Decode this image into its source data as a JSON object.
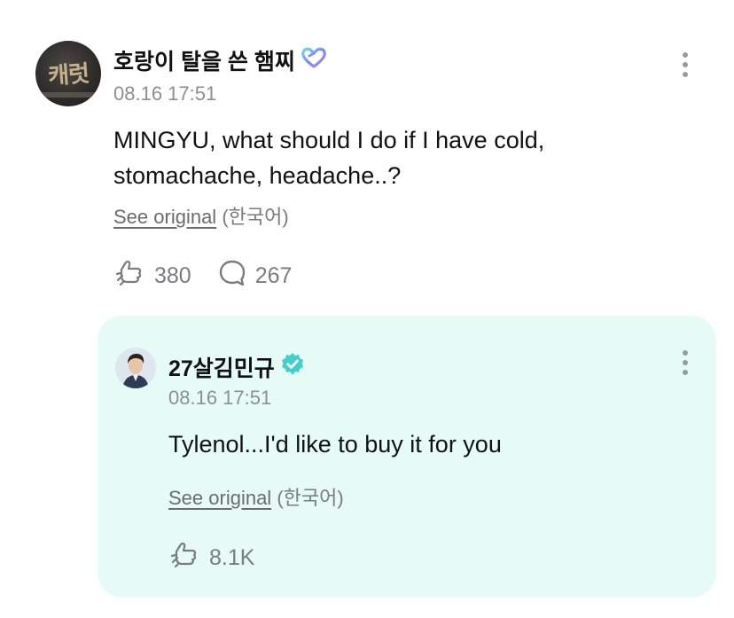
{
  "post": {
    "author_name": "호랑이 탈을 쓴 햄찌",
    "avatar_text": "캐럿",
    "timestamp": "08.16 17:51",
    "body_line1": "MINGYU, what should I do if I have cold,",
    "body_line2": "stomachache, headache..?",
    "see_original": "See original",
    "original_language": "(한국어)",
    "like_count": "380",
    "comment_count": "267",
    "badge_icon": "heart-outline-icon"
  },
  "reply": {
    "author_name": "27살김민규",
    "timestamp": "08.16 17:51",
    "body": "Tylenol...I'd like to buy it for you",
    "see_original": "See original",
    "original_language": "(한국어)",
    "like_count": "8.1K",
    "badge_icon": "verified-check-icon"
  },
  "colors": {
    "reply_background": "#e6fbf5",
    "verified_badge": "#3fd0c9",
    "muted_text": "#7b7b80"
  }
}
